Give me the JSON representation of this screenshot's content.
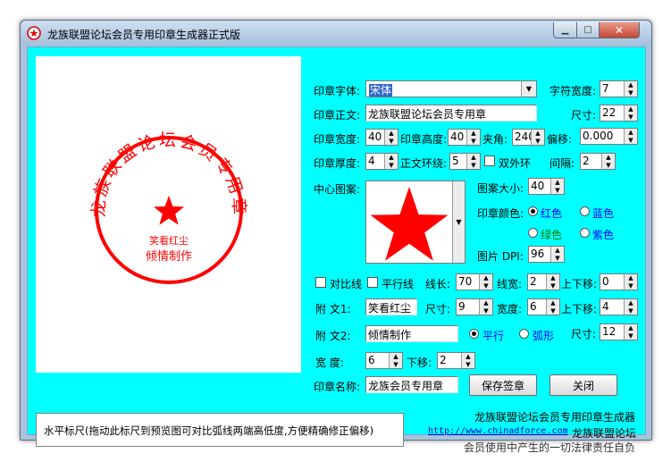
{
  "window": {
    "title": "龙族联盟论坛会员专用印章生成器正式版"
  },
  "seal": {
    "arc_text": "龙族联盟论坛会员专用章",
    "line1": "笑看红尘",
    "line2": "倾情制作",
    "color": "#ff0000"
  },
  "form": {
    "font_label": "印章字体:",
    "font_value": "宋体",
    "char_width_label": "字符宽度:",
    "char_width_value": "7",
    "body_label": "印章正文:",
    "body_value": "龙族联盟论坛会员专用章",
    "size_label": "尺寸:",
    "size_value": "22",
    "seal_width_label": "印章宽度:",
    "seal_width_value": "40",
    "seal_height_label": "印章高度:",
    "seal_height_value": "40",
    "angle_label": "夹角:",
    "angle_value": "240",
    "offset_label": "偏移:",
    "offset_value": "0.000",
    "thickness_label": "印章厚度:",
    "thickness_value": "4",
    "wrap_label": "正文环绕:",
    "wrap_value": "5",
    "double_ring_label": "双外环",
    "spacing_label": "间隔:",
    "spacing_value": "2",
    "center_image_label": "中心图案:",
    "pattern_size_label": "图案大小:",
    "pattern_size_value": "40",
    "seal_color_label": "印章颜色:",
    "color_red": "红色",
    "color_blue": "蓝色",
    "color_green": "绿色",
    "color_purple": "紫色",
    "dpi_label": "图片 DPI:",
    "dpi_value": "96",
    "contrast_line_label": "对比线",
    "parallel_line_label": "平行线",
    "line_length_label": "线长:",
    "line_length_value": "70",
    "line_width_label": "线宽:",
    "line_width_value": "2",
    "line_shift_label": "上下移:",
    "line_shift_value": "0",
    "sub1_label": "附  文1:",
    "sub1_value": "笑看红尘",
    "sub1_size_label": "尺寸:",
    "sub1_size_value": "9",
    "sub1_width_label": "宽度:",
    "sub1_width_value": "6",
    "sub1_shift_label": "上下移:",
    "sub1_shift_value": "4",
    "sub2_label": "附  文2:",
    "sub2_value": "倾情制作",
    "parallel_radio_label": "平行",
    "arc_radio_label": "弧形",
    "sub2_size_label": "尺寸:",
    "sub2_size_value": "12",
    "width_label": "宽    度:",
    "width_value": "6",
    "down_label": "下移:",
    "down_value": "2",
    "name_label": "印章名称:",
    "name_value": "龙族会员专用章",
    "save_button": "保存签章",
    "close_button": "关闭"
  },
  "status": {
    "ruler_text": "水平标尺(拖动此标尺到预览图可对比弧线两端高低度,方便精确修正偏移)"
  },
  "footer": {
    "line1": "龙族联盟论坛会员专用印章生成器",
    "url": "http://www.chinadforce.com",
    "line2_suffix": "龙族联盟论坛",
    "line3": "会员使用中产生的一切法律责任自负"
  },
  "colors": {
    "client_bg": "#00ffff",
    "seal_red": "#ff0000",
    "label_blue": "#0000ff",
    "label_green": "#007a00"
  }
}
